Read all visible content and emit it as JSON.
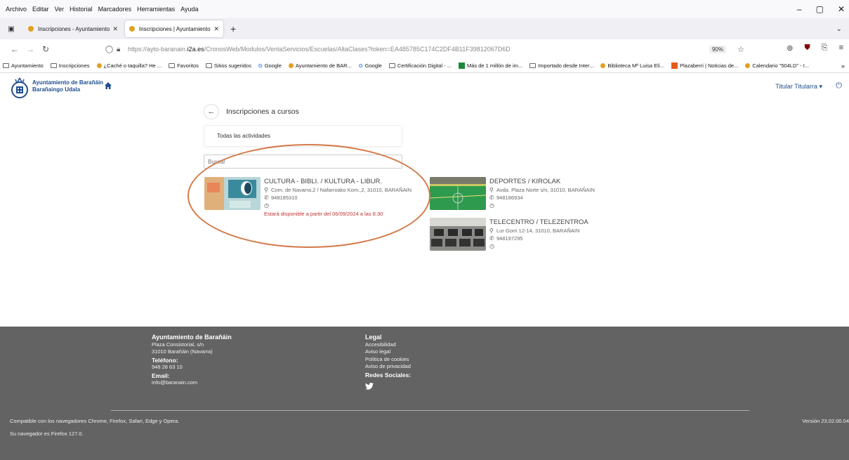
{
  "browser": {
    "menu": [
      "Archivo",
      "Editar",
      "Ver",
      "Historial",
      "Marcadores",
      "Herramientas",
      "Ayuda"
    ],
    "window_controls": [
      "–",
      "▢",
      "✕"
    ],
    "tabs": [
      {
        "label": "Inscripciones - Ayuntamiento d",
        "active": false
      },
      {
        "label": "Inscripciones | Ayuntamiento d",
        "active": true
      }
    ],
    "new_tab": "+",
    "url_prefix": "https://ayto-baranain.",
    "url_domain": "i2a.es",
    "url_path": "/CronosWeb/Modulos/VentaServicios/Escuelas/AltaClases?token=EA485785C174C2DF4B11F39812067D6D",
    "zoom": "90%",
    "bookmarks": [
      {
        "label": "Ayuntamiento",
        "icon": "folder-icon"
      },
      {
        "label": "Inscripciones",
        "icon": "folder-icon"
      },
      {
        "label": "¿Caché o taquilla? He ...",
        "icon": "site-icon"
      },
      {
        "label": "Favoritos",
        "icon": "folder-icon"
      },
      {
        "label": "Sitios sugeridos",
        "icon": "globe-icon"
      },
      {
        "label": "Google",
        "icon": "google-icon"
      },
      {
        "label": "Ayuntamiento de BAR...",
        "icon": "site-icon"
      },
      {
        "label": "Google",
        "icon": "google-icon"
      },
      {
        "label": "Certificación Digital - ...",
        "icon": "cert-icon"
      },
      {
        "label": "Más de 1 millón de im...",
        "icon": "dx-icon"
      },
      {
        "label": "Importado desde Inter...",
        "icon": "folder-icon"
      },
      {
        "label": "Biblioteca Mª Luisa Elí...",
        "icon": "site-icon"
      },
      {
        "label": "Plazaberri | Noticias de...",
        "icon": "plazaberri-icon"
      },
      {
        "label": "Calendario \"504LD\" - I...",
        "icon": "calendar-icon"
      }
    ]
  },
  "app": {
    "logo_line1": "Ayuntamiento de Barañáin",
    "logo_line2": "Barañaingo Udala",
    "user": "Titular Titularra",
    "user_caret": "▾"
  },
  "main": {
    "title": "Inscripciones a cursos",
    "filter": "Todas las actividades",
    "search_placeholder": "Buscar",
    "cards": [
      {
        "name": "CULTURA - BIBLI. / KULTURA - LIBUR.",
        "address": "Com. de Navarra,2 / Nafarroako Kom.,2, 31010, BARAÑAIN",
        "phone": "948185310",
        "notice": "Estará disponible a partir del 06/09/2024 a las 8:30"
      },
      {
        "name": "DEPORTES / KIROLAK",
        "address": "Avda. Plaza Norte s/n, 31010, BARAÑAIN",
        "phone": "948186934",
        "notice": ""
      },
      {
        "name": "TELECENTRO / TELEZENTROA",
        "address": "Lur Gorri 12-14, 31010, BARAÑAIN",
        "phone": "948197295",
        "notice": ""
      }
    ]
  },
  "footer": {
    "org_title": "Ayuntamiento de Barañáin",
    "address1": "Plaza Consistorial, s/n",
    "address2": "31010 Barañáin (Navarra)",
    "phone_label": "Teléfono:",
    "phone": "948 28 63 10",
    "email_label": "Email:",
    "email": "info@baranain.com",
    "legal_title": "Legal",
    "legal_links": [
      "Accesibilidad",
      "Aviso legal",
      "Política de cookies",
      "Aviso de privacidad"
    ],
    "social_title": "Redes Sociales:",
    "compat": "Compatible con los navegadores Chrome, Firefox, Safari, Edge y Opera.",
    "browser_info": "Su navegador es Firefox 127.0.",
    "version": "Versión 23.02.00.04"
  },
  "colors": {
    "brand": "#1f4e8c",
    "notice": "#bb3333",
    "footer_bg": "#636363",
    "annotation": "#d47a4a"
  }
}
